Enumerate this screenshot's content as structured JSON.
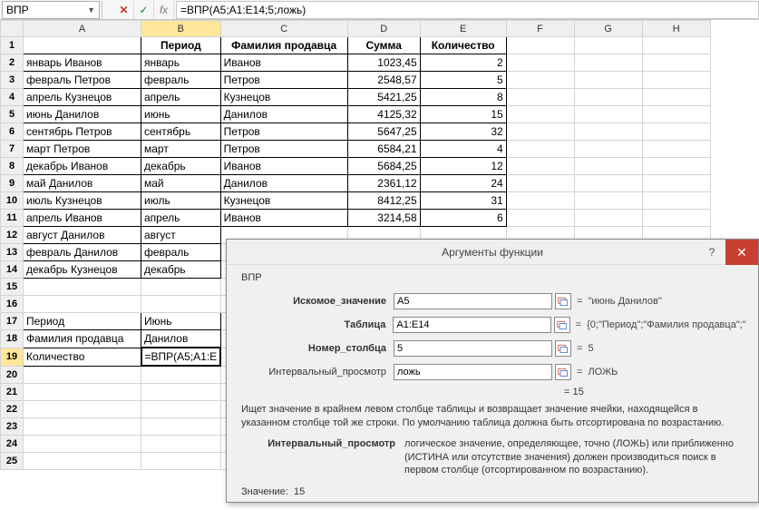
{
  "namebox": "ВПР",
  "formula": "=ВПР(A5;A1:E14;5;ложь)",
  "col_headers": [
    "",
    "A",
    "B",
    "C",
    "D",
    "E",
    "F",
    "G",
    "H"
  ],
  "headers_row": {
    "B": "Период",
    "C": "Фамилия продавца",
    "D": "Сумма",
    "E": "Количество"
  },
  "rows": [
    {
      "n": 2,
      "A": "январь Иванов",
      "B": "январь",
      "C": "Иванов",
      "D": "1023,45",
      "E": "2"
    },
    {
      "n": 3,
      "A": "февраль Петров",
      "B": "февраль",
      "C": "Петров",
      "D": "2548,57",
      "E": "5"
    },
    {
      "n": 4,
      "A": "апрель Кузнецов",
      "B": "апрель",
      "C": "Кузнецов",
      "D": "5421,25",
      "E": "8"
    },
    {
      "n": 5,
      "A": "июнь Данилов",
      "B": "июнь",
      "C": "Данилов",
      "D": "4125,32",
      "E": "15"
    },
    {
      "n": 6,
      "A": "сентябрь Петров",
      "B": "сентябрь",
      "C": "Петров",
      "D": "5647,25",
      "E": "32"
    },
    {
      "n": 7,
      "A": "март Петров",
      "B": "март",
      "C": "Петров",
      "D": "6584,21",
      "E": "4"
    },
    {
      "n": 8,
      "A": "декабрь Иванов",
      "B": "декабрь",
      "C": "Иванов",
      "D": "5684,25",
      "E": "12"
    },
    {
      "n": 9,
      "A": "май Данилов",
      "B": "май",
      "C": "Данилов",
      "D": "2361,12",
      "E": "24"
    },
    {
      "n": 10,
      "A": "июль Кузнецов",
      "B": "июль",
      "C": "Кузнецов",
      "D": "8412,25",
      "E": "31"
    },
    {
      "n": 11,
      "A": "апрель Иванов",
      "B": "апрель",
      "C": "Иванов",
      "D": "3214,58",
      "E": "6"
    },
    {
      "n": 12,
      "A": "август Данилов",
      "B": "август"
    },
    {
      "n": 13,
      "A": "февраль Данилов",
      "B": "февраль"
    },
    {
      "n": 14,
      "A": "декабрь Кузнецов",
      "B": "декабрь"
    }
  ],
  "lookup": {
    "r17": {
      "A": "Период",
      "B": "Июнь"
    },
    "r18": {
      "A": "Фамилия продавца",
      "B": "Данилов"
    },
    "r19": {
      "A": "Количество",
      "B": "=ВПР(A5;A1:E"
    }
  },
  "dialog": {
    "title": "Аргументы функции",
    "fn": "ВПР",
    "args": [
      {
        "label": "Искомое_значение",
        "bold": true,
        "value": "A5",
        "result": "\"июнь Данилов\""
      },
      {
        "label": "Таблица",
        "bold": true,
        "value": "A1:E14",
        "result": "{0;\"Период\";\"Фамилия продавца\";\""
      },
      {
        "label": "Номер_столбца",
        "bold": true,
        "value": "5",
        "result": "5"
      },
      {
        "label": "Интервальный_просмотр",
        "bold": false,
        "value": "ложь",
        "result": "ЛОЖЬ"
      }
    ],
    "final_eq": "= 15",
    "desc": "Ищет значение в крайнем левом столбце таблицы и возвращает значение ячейки, находящейся в указанном столбце той же строки. По умолчанию таблица должна быть отсортирована по возрастанию.",
    "arg_desc_label": "Интервальный_просмотр",
    "arg_desc": "логическое значение, определяющее, точно (ЛОЖЬ) или приближенно (ИСТИНА или отсутствие значения) должен производиться поиск в первом столбце (отсортированном по возрастанию).",
    "value_label": "Значение:",
    "value": "15"
  }
}
